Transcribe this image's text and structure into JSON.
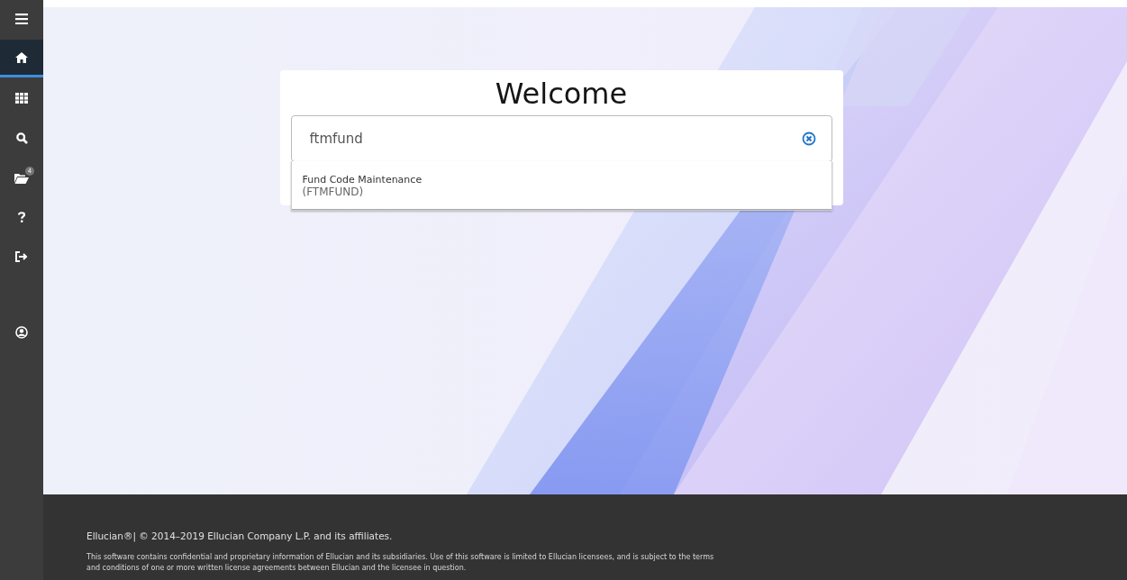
{
  "sidebar": {
    "items": [
      {
        "kind": "menu",
        "selected": false
      },
      {
        "kind": "home",
        "selected": true
      },
      {
        "kind": "apps",
        "selected": false
      },
      {
        "kind": "search",
        "selected": false
      },
      {
        "kind": "folder",
        "selected": false,
        "badge": "4"
      },
      {
        "kind": "help",
        "selected": false
      },
      {
        "kind": "signout",
        "selected": false
      },
      {
        "kind": "user",
        "selected": false
      }
    ]
  },
  "welcome": {
    "title": "Welcome",
    "search": {
      "value": "ftmfund"
    },
    "results": [
      {
        "name": "Fund Code Maintenance",
        "code": "(FTMFUND)"
      }
    ]
  },
  "footer": {
    "copyright": "Ellucian®| © 2014–2019 Ellucian Company L.P. and its affiliates.",
    "notice": "This software contains confidential and proprietary information of Ellucian and its subsidiaries. Use of this software is limited to Ellucian licensees, and is subject to the terms and conditions of one or more written license agreements between Ellucian and the licensee in question."
  }
}
